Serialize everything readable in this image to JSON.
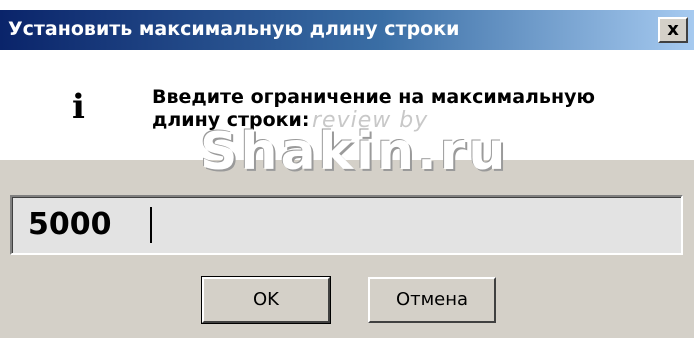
{
  "window": {
    "title": "Установить максимальную длину строки",
    "close_label": "x"
  },
  "dialog": {
    "icon": "info-icon",
    "message": "Введите ограничение на максимальную длину строки:"
  },
  "input": {
    "value": "5000"
  },
  "buttons": {
    "ok_label": "OK",
    "cancel_label": "Отмена"
  },
  "watermark": {
    "line1": "review by",
    "line2": "Shakin.ru"
  },
  "colors": {
    "titlebar_start": "#0a246a",
    "titlebar_end": "#a6caf0",
    "dialog_face": "#d4d0c8"
  }
}
